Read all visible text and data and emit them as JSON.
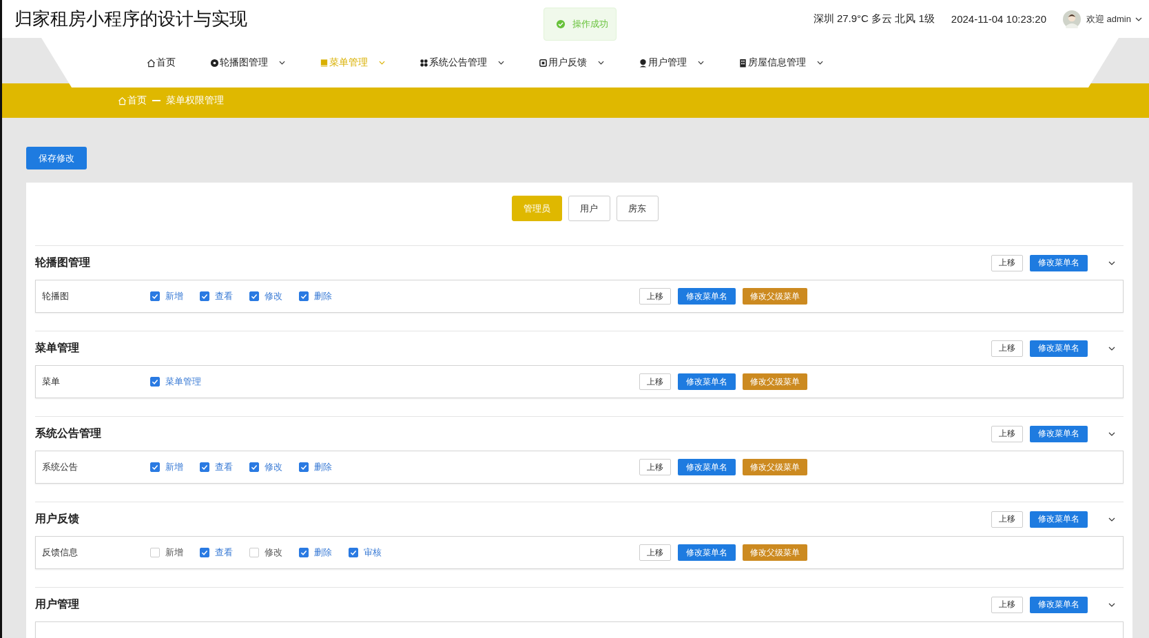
{
  "app_title": "归家租房小程序的设计与实现",
  "toast": {
    "message": "操作成功"
  },
  "weather": "深圳 27.9°C 多云 北风 1级",
  "datetime": "2024-11-04 10:23:20",
  "user": {
    "greeting": "欢迎 admin"
  },
  "nav": [
    {
      "label": "首页",
      "selected": false
    },
    {
      "label": "轮播图管理",
      "selected": false
    },
    {
      "label": "菜单管理",
      "selected": true
    },
    {
      "label": "系统公告管理",
      "selected": false
    },
    {
      "label": "用户反馈",
      "selected": false
    },
    {
      "label": "用户管理",
      "selected": false
    },
    {
      "label": "房屋信息管理",
      "selected": false
    }
  ],
  "breadcrumb": [
    {
      "label": "首页"
    },
    {
      "label": "菜单权限管理"
    }
  ],
  "save_button": "保存修改",
  "roles": [
    {
      "label": "管理员",
      "selected": true
    },
    {
      "label": "用户",
      "selected": false
    },
    {
      "label": "房东",
      "selected": false
    }
  ],
  "groups": [
    {
      "title": "轮播图管理",
      "move_up": "上移",
      "rename": "修改菜单名",
      "subs": [
        {
          "name": "轮播图",
          "permissions": [
            {
              "label": "新增",
              "checked": true
            },
            {
              "label": "查看",
              "checked": true
            },
            {
              "label": "修改",
              "checked": true
            },
            {
              "label": "删除",
              "checked": true
            }
          ],
          "move_up": "上移",
          "rename": "修改菜单名",
          "change_parent": "修改父级菜单"
        }
      ]
    },
    {
      "title": "菜单管理",
      "move_up": "上移",
      "rename": "修改菜单名",
      "subs": [
        {
          "name": "菜单",
          "permissions": [
            {
              "label": "菜单管理",
              "checked": true
            }
          ],
          "move_up": "上移",
          "rename": "修改菜单名",
          "change_parent": "修改父级菜单"
        }
      ]
    },
    {
      "title": "系统公告管理",
      "move_up": "上移",
      "rename": "修改菜单名",
      "subs": [
        {
          "name": "系统公告",
          "permissions": [
            {
              "label": "新增",
              "checked": true
            },
            {
              "label": "查看",
              "checked": true
            },
            {
              "label": "修改",
              "checked": true
            },
            {
              "label": "删除",
              "checked": true
            }
          ],
          "move_up": "上移",
          "rename": "修改菜单名",
          "change_parent": "修改父级菜单"
        }
      ]
    },
    {
      "title": "用户反馈",
      "move_up": "上移",
      "rename": "修改菜单名",
      "subs": [
        {
          "name": "反馈信息",
          "permissions": [
            {
              "label": "新增",
              "checked": false
            },
            {
              "label": "查看",
              "checked": true
            },
            {
              "label": "修改",
              "checked": false
            },
            {
              "label": "删除",
              "checked": true
            },
            {
              "label": "审核",
              "checked": true
            }
          ],
          "move_up": "上移",
          "rename": "修改菜单名",
          "change_parent": "修改父级菜单"
        }
      ]
    },
    {
      "title": "用户管理",
      "move_up": "上移",
      "rename": "修改菜单名"
    }
  ]
}
